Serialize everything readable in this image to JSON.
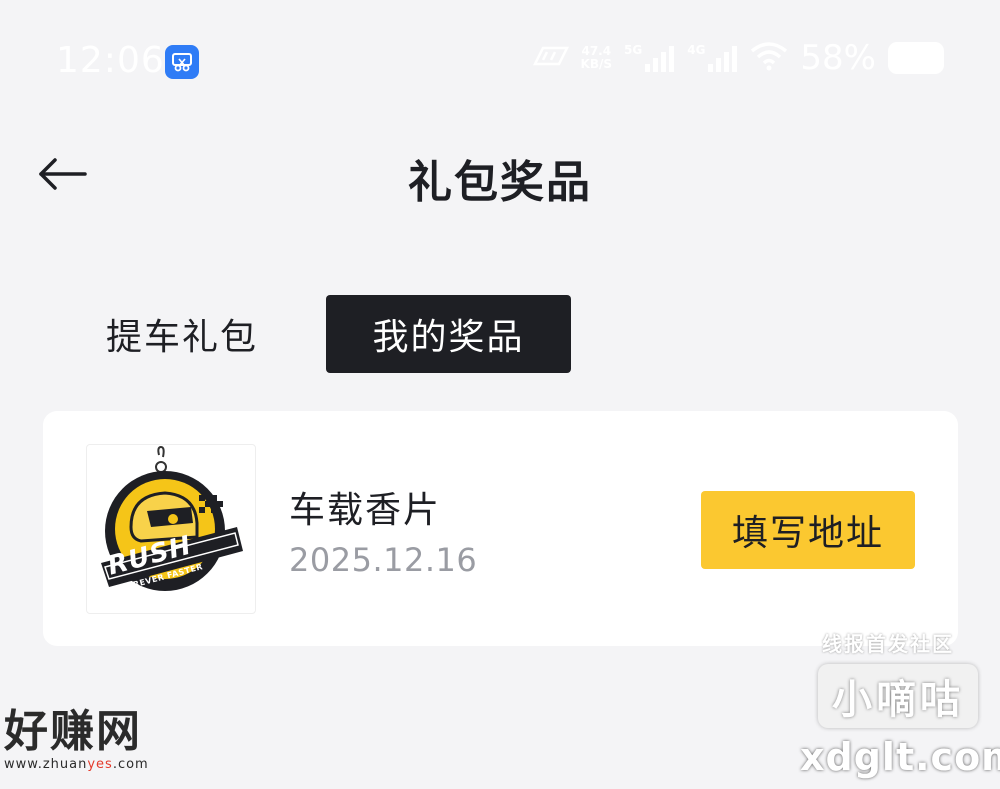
{
  "status_bar": {
    "time": "12:06",
    "app_icon": "scissors-icon",
    "network_speed_value": "47.4",
    "network_speed_unit": "KB/S",
    "signal_1_label": "5G",
    "signal_2_label": "4G",
    "battery_percent": "58%"
  },
  "header": {
    "back_icon": "back-arrow-icon",
    "title": "礼包奖品"
  },
  "tabs": [
    {
      "label": "提车礼包",
      "active": false
    },
    {
      "label": "我的奖品",
      "active": true
    }
  ],
  "prize_card": {
    "image": "car-air-freshener-rush-logo",
    "logo_text": "RUSH",
    "logo_subtext": "FOREVER FASTER",
    "name": "车载香片",
    "date": "2025.12.16",
    "action_label": "填写地址"
  },
  "watermarks": {
    "left_big": "好赚网",
    "left_url_prefix": "www.zhuan",
    "left_url_highlight": "yes",
    "left_url_suffix": ".com",
    "right_small": "线报首发社区",
    "right_box": "小嘀咕",
    "right_url": "xdglt.com"
  },
  "colors": {
    "background": "#f4f4f6",
    "active_tab": "#1e1f24",
    "action_button": "#fbc830",
    "date_text": "#9a9ca3"
  }
}
